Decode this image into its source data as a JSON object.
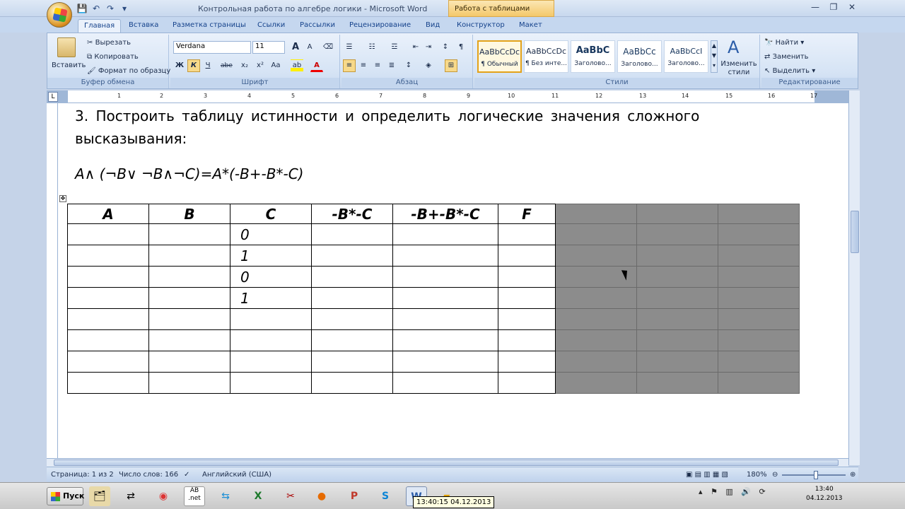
{
  "window": {
    "title": "Контрольная работа по алгебре логики - Microsoft Word",
    "context_tab": "Работа с таблицами"
  },
  "qat": {
    "save_icon": "💾",
    "undo_icon": "↶",
    "redo_icon": "↷",
    "dropdown_icon": "▾"
  },
  "tabs": [
    "Главная",
    "Вставка",
    "Разметка страницы",
    "Ссылки",
    "Рассылки",
    "Рецензирование",
    "Вид",
    "Конструктор",
    "Макет"
  ],
  "ribbon": {
    "clipboard": {
      "paste": "Вставить",
      "cut": "Вырезать",
      "copy": "Копировать",
      "format_painter": "Формат по образцу",
      "label": "Буфер обмена"
    },
    "font": {
      "name": "Verdana",
      "size": "11",
      "label": "Шрифт",
      "bold": "Ж",
      "italic": "К",
      "underline": "Ч",
      "strike": "abe",
      "sub": "x₂",
      "sup": "x²",
      "case": "Aa",
      "grow": "A",
      "shrink": "A"
    },
    "paragraph": {
      "label": "Абзац",
      "pilcrow": "¶"
    },
    "styles": {
      "label": "Стили",
      "items": [
        {
          "sample": "AaBbCcDc",
          "name": "¶ Обычный"
        },
        {
          "sample": "AaBbCcDc",
          "name": "¶ Без инте..."
        },
        {
          "sample": "AaBbC",
          "name": "Заголово..."
        },
        {
          "sample": "AaBbCc",
          "name": "Заголово..."
        },
        {
          "sample": "AaBbCcI",
          "name": "Заголово..."
        }
      ],
      "change": "Изменить стили"
    },
    "editing": {
      "find": "Найти",
      "replace": "Заменить",
      "select": "Выделить",
      "label": "Редактирование"
    }
  },
  "ruler_numbers": [
    "1",
    "2",
    "3",
    "4",
    "5",
    "6",
    "7",
    "8",
    "9",
    "10",
    "11",
    "12",
    "13",
    "14",
    "15",
    "16",
    "17"
  ],
  "document": {
    "line1": "3. Построить таблицу истинности и определить логические значения сложного",
    "line2": "высказывания:",
    "formula": "A∧ (¬B∨ ¬B∧¬C)=A*(-B+-B*-C)",
    "table": {
      "headers": [
        "A",
        "B",
        "C",
        "-B*-C",
        "-B+-B*-C",
        "F",
        "",
        "",
        ""
      ],
      "c_values": [
        "0",
        "1",
        "0",
        "1",
        "",
        "",
        "",
        ""
      ]
    }
  },
  "status": {
    "page": "Страница: 1 из 2",
    "words": "Число слов: 166",
    "lang": "Английский (США)",
    "zoom": "180%"
  },
  "taskbar": {
    "start": "Пуск",
    "tooltip": "13:40:15 04.12.2013",
    "time": "13:40",
    "date": "04.12.2013"
  }
}
